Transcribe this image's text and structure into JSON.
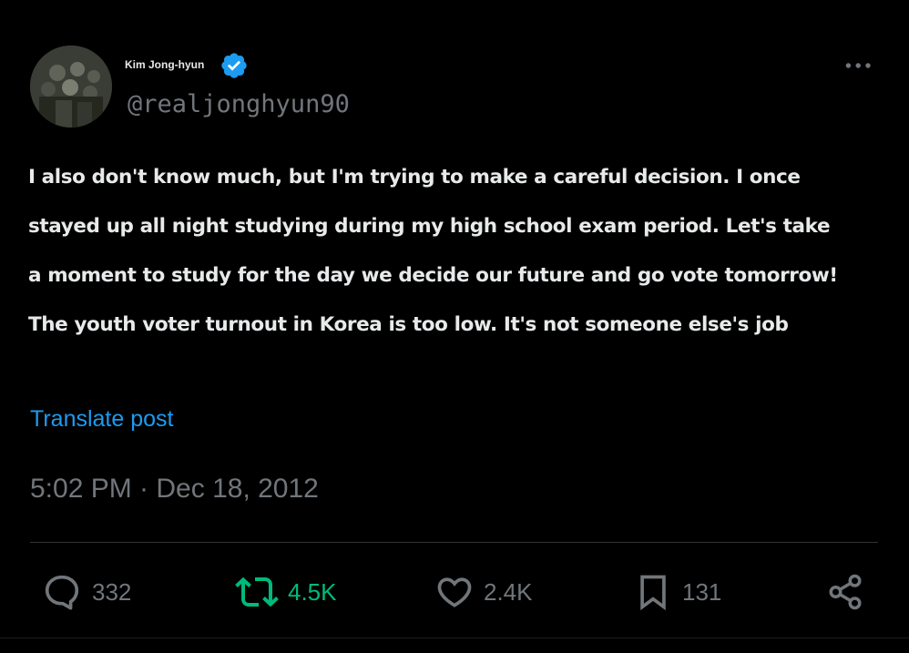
{
  "author": {
    "display_name": "Kim Jong-hyun",
    "handle": "@realjonghyun90",
    "verified": true,
    "verified_color": "#1d9bf0"
  },
  "post": {
    "lines": [
      "I also don't know much, but I'm trying to make a careful decision. I once",
      "stayed up all night studying during my high school exam period. Let's take",
      "a moment to study for the day we decide our future and go vote tomorrow!",
      "The youth voter turnout in Korea is too low. It's not someone else's job"
    ],
    "translate_label": "Translate post",
    "timestamp": "5:02 PM · Dec 18, 2012"
  },
  "actions": {
    "reply": {
      "count": "332",
      "icon": "reply-icon"
    },
    "repost": {
      "count": "4.5K",
      "icon": "repost-icon",
      "color": "#00ba7c"
    },
    "like": {
      "count": "2.4K",
      "icon": "heart-icon"
    },
    "bookmark": {
      "count": "131",
      "icon": "bookmark-icon"
    },
    "share": {
      "icon": "share-icon"
    }
  },
  "colors": {
    "background": "#000000",
    "text": "#e7e9ea",
    "muted": "#71767b",
    "link": "#1d9bf0"
  }
}
